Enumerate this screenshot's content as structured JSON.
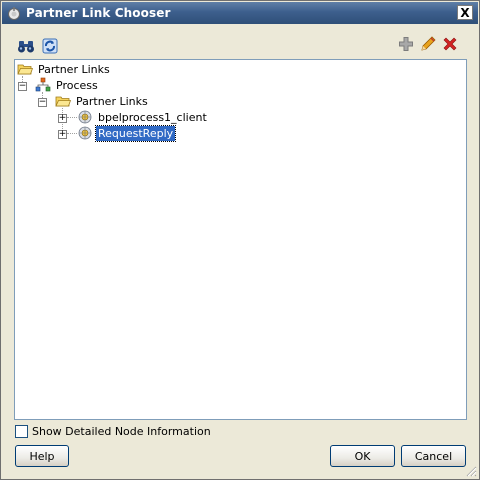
{
  "window": {
    "title": "Partner Link Chooser",
    "close_label": "X"
  },
  "toolbar": {
    "left": [
      {
        "icon": "binoculars-icon"
      },
      {
        "icon": "refresh-icon"
      }
    ],
    "right": [
      {
        "icon": "add-icon"
      },
      {
        "icon": "edit-icon"
      },
      {
        "icon": "delete-icon"
      }
    ]
  },
  "tree": {
    "root": {
      "label": "Partner Links",
      "icon": "folder-open-icon"
    },
    "process": {
      "label": "Process",
      "icon": "process-icon",
      "expander": "−"
    },
    "partner_links": {
      "label": "Partner Links",
      "icon": "folder-open-icon",
      "expander": "−"
    },
    "items": [
      {
        "label": "bpelprocess1_client",
        "icon": "partner-link-icon",
        "expander": "+",
        "selected": false
      },
      {
        "label": "RequestReply",
        "icon": "partner-link-icon",
        "expander": "+",
        "selected": true
      }
    ]
  },
  "options": {
    "show_detailed_label": "Show Detailed Node Information",
    "checked": false
  },
  "buttons": {
    "help": "Help",
    "ok": "OK",
    "cancel": "Cancel"
  },
  "colors": {
    "selection": "#316ac5",
    "titlebar": "#3d5f8d",
    "dialog_bg": "#ece9d8"
  }
}
